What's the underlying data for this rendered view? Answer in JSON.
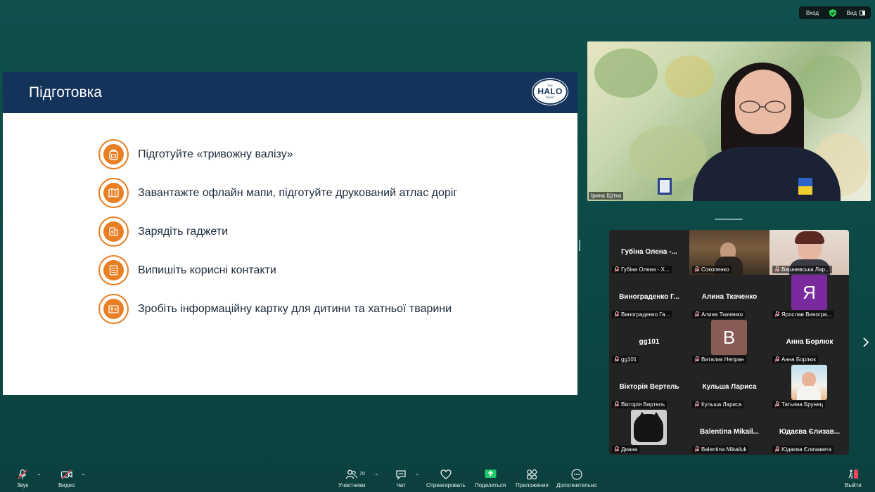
{
  "top_bar": {
    "login_label": "Вход",
    "view_label": "Вид",
    "shield_color": "#2ecc55"
  },
  "slide": {
    "title": "Підготовка",
    "logo_top": "THE",
    "logo_main": "HALO",
    "logo_bottom": "TRUST",
    "accent_color": "#e97f24",
    "header_color": "#14335a",
    "items": [
      {
        "icon": "backpack-icon",
        "text": "Підготуйте «тривожну валізу»"
      },
      {
        "icon": "map-icon",
        "text": "Завантажте офлайн мапи, підготуйте друкований атлас доріг"
      },
      {
        "icon": "gadgets-icon",
        "text": "Зарядіть гаджети"
      },
      {
        "icon": "contacts-list-icon",
        "text": "Випишіть корисні контакти"
      },
      {
        "icon": "id-card-icon",
        "text": "Зробіть інформаційну картку для дитини та хатньої тварини"
      }
    ]
  },
  "speaker": {
    "name": "Ірина Щітка"
  },
  "gallery": {
    "tiles": [
      {
        "big": "Губіна Олена -...",
        "small": "Губіна Олена - Х...",
        "kind": "name"
      },
      {
        "big": "",
        "small": "Соколенко",
        "kind": "video"
      },
      {
        "big": "",
        "small": "Вишневська Лар...",
        "kind": "video2"
      },
      {
        "big": "Винограденко  Г...",
        "small": "Винограденко Га...",
        "kind": "name"
      },
      {
        "big": "Алина Ткаченко",
        "small": "Алина Ткаченко",
        "kind": "name"
      },
      {
        "big": "Я",
        "small": "Ярослав Виногра...",
        "kind": "avatar",
        "color": "#7b2a9e"
      },
      {
        "big": "gg101",
        "small": "gg101",
        "kind": "name"
      },
      {
        "big": "B",
        "small": "Виталик Непран",
        "kind": "avatar",
        "color": "#8a5a56"
      },
      {
        "big": "Анна Борлюк",
        "small": "Анна Борлюк",
        "kind": "name"
      },
      {
        "big": "Вікторія Вертель",
        "small": "Вікторія Вертель",
        "kind": "name"
      },
      {
        "big": "Кульша Лариса",
        "small": "Кульша Лариса",
        "kind": "name"
      },
      {
        "big": "",
        "small": "Татьяна Брунец",
        "kind": "photo"
      },
      {
        "big": "",
        "small": "Диана",
        "kind": "cat"
      },
      {
        "big": "Balentina  Mikail...",
        "small": "Balentina Mikailuk",
        "kind": "name"
      },
      {
        "big": "Юдаєва Єлизав...",
        "small": "Юдаєва Єлизавета",
        "kind": "name"
      }
    ]
  },
  "toolbar": {
    "audio_label": "Звук",
    "video_label": "Видео",
    "participants_label": "Участники",
    "participants_count": "70",
    "chat_label": "Чат",
    "react_label": "Отреагировать",
    "share_label": "Поделиться",
    "apps_label": "Приложения",
    "more_label": "Дополнительно",
    "leave_label": "Выйти",
    "share_color": "#1ec96b",
    "mute_color": "#e8475a"
  }
}
